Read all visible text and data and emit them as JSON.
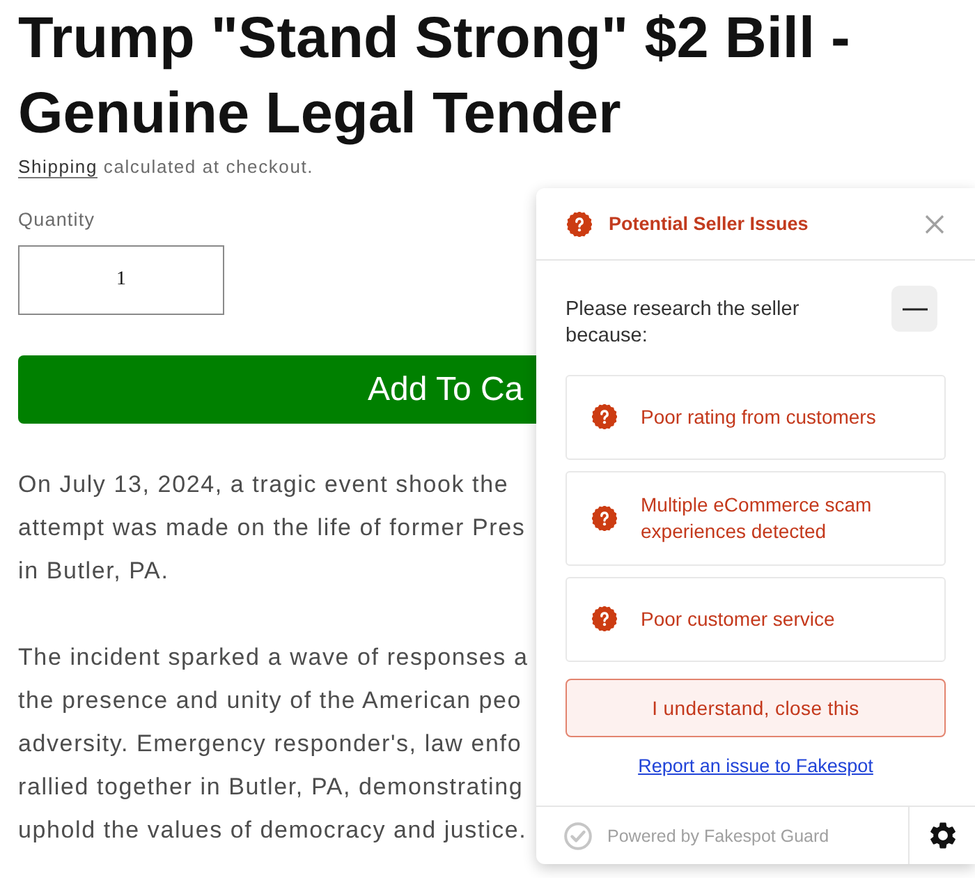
{
  "product": {
    "title": "Trump \"Stand Strong\" $2 Bill - Genuine Legal Tender",
    "shipping": {
      "link": "Shipping",
      "text": "calculated at checkout."
    },
    "quantity": {
      "label": "Quantity",
      "value": "1"
    },
    "add_to_cart": "Add To Ca",
    "description": [
      {
        "lines": [
          "On July 13, 2024, a tragic event shook the",
          "attempt was made on the life of former Pres",
          "in Butler, PA."
        ]
      },
      {
        "lines": [
          "The incident sparked a wave of responses a",
          "the presence and unity of the American peo",
          "adversity. Emergency responder's, law enfo",
          "rallied together in Butler, PA, demonstrating",
          "uphold the values of democracy and justice."
        ]
      }
    ]
  },
  "seller_panel": {
    "title": "Potential Seller Issues",
    "intro": "Please research the seller because:",
    "expanded": true,
    "issues": [
      {
        "text": "Poor rating from customers"
      },
      {
        "text": "Multiple eCommerce scam experiences detected"
      },
      {
        "text": "Poor customer service"
      }
    ],
    "confirm_button": "I understand, close this",
    "report_link": "Report an issue to Fakespot",
    "footer_text": "Powered by Fakespot Guard"
  }
}
